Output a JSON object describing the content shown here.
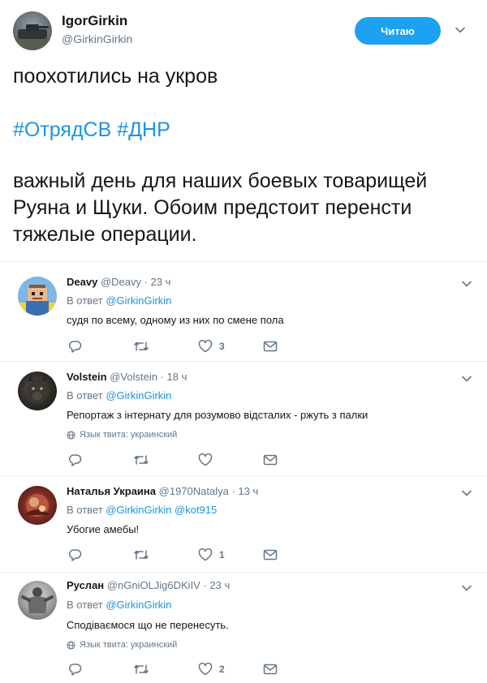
{
  "author": {
    "display_name": "IgorGirkin",
    "handle": "@GirkinGirkin",
    "follow_label": "Читаю"
  },
  "tweet": {
    "line1": "поохотились на укров",
    "hashtags": "#ОтрядСВ #ДНР",
    "line3": "важный день для наших боевых товарищей Руяна и Щуки. Обоим предстоит перенсти тяжелые операции."
  },
  "replies": [
    {
      "name": "Deavy",
      "meta": "@Deavy · 23 ч",
      "in_reply_prefix": "В ответ ",
      "in_reply_to": "@GirkinGirkin",
      "text": "судя по всему, одному из них по смене пола",
      "lang": "",
      "likes": "3"
    },
    {
      "name": "Volstein",
      "meta": "@Volstein · 18 ч",
      "in_reply_prefix": "В ответ ",
      "in_reply_to": "@GirkinGirkin",
      "text": "Репортаж з інтернату для розумово відсталих - ржуть з палки",
      "lang": "Язык твита: украинский",
      "likes": ""
    },
    {
      "name": "Наталья Украина",
      "meta": "@1970Natalya · 13 ч",
      "in_reply_prefix": "В ответ ",
      "in_reply_to": "@GirkinGirkin @kot915",
      "text": "Убогие амебы!",
      "lang": "",
      "likes": "1"
    },
    {
      "name": "Руслан",
      "meta": "@nGniOLJig6DKiIV · 23 ч",
      "in_reply_prefix": "В ответ ",
      "in_reply_to": "@GirkinGirkin",
      "text": "Сподіваємося що не перенесуть.",
      "lang": "Язык твита: украинский",
      "likes": "2"
    }
  ],
  "colors": {
    "accent": "#1da1f2",
    "link": "#1b95e0",
    "muted": "#657786",
    "text": "#14171a",
    "divider": "#e6ecf0"
  },
  "icons": [
    "chevron-down-icon",
    "reply-icon",
    "retweet-icon",
    "like-icon",
    "message-icon",
    "globe-icon"
  ]
}
